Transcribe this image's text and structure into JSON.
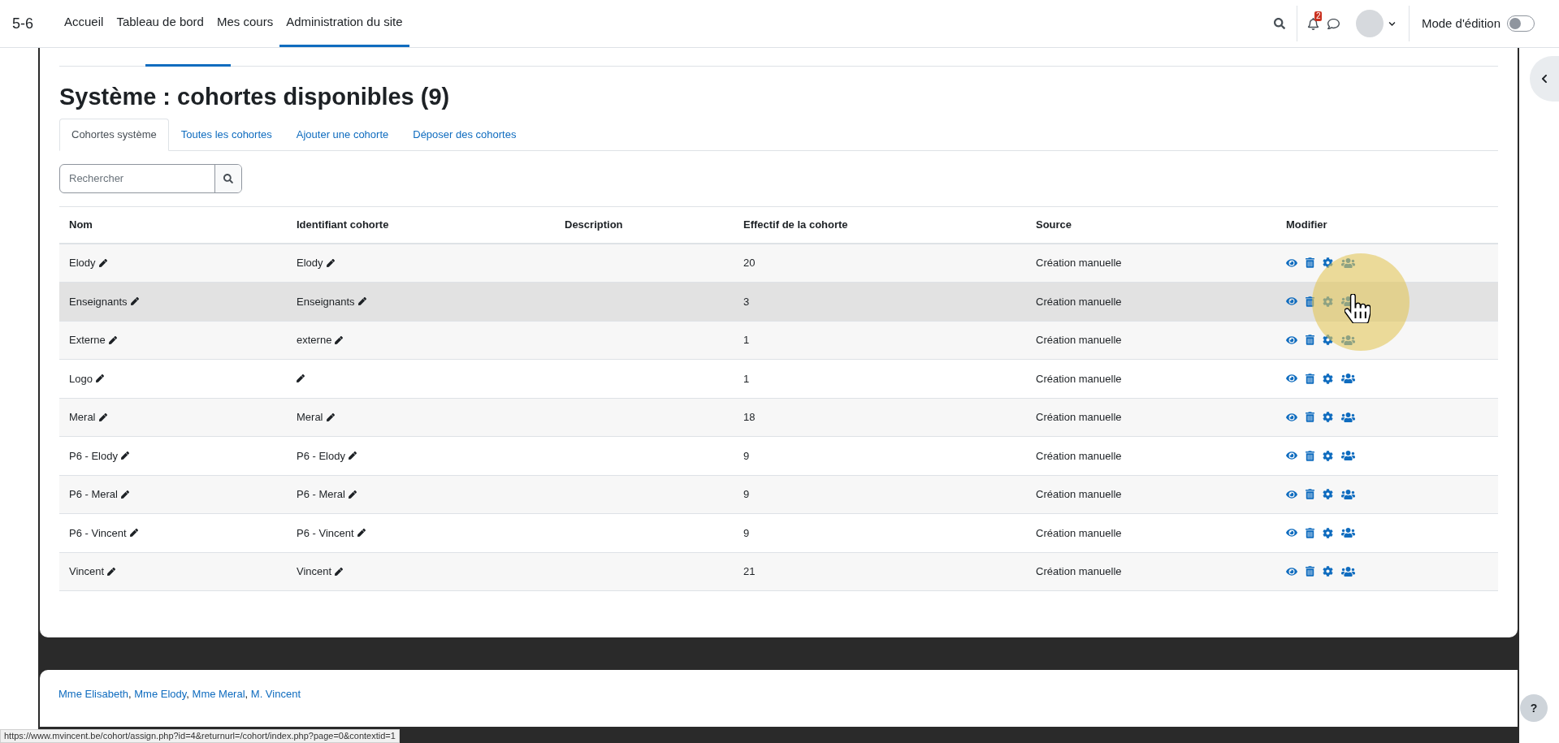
{
  "navbar": {
    "brand": "5-6",
    "items": [
      {
        "label": "Accueil",
        "selected": false
      },
      {
        "label": "Tableau de bord",
        "selected": false
      },
      {
        "label": "Mes cours",
        "selected": false
      },
      {
        "label": "Administration du site",
        "selected": true
      }
    ],
    "notifications": "2",
    "edit_mode": {
      "label": "Mode d'édition",
      "on": false
    }
  },
  "heading": "Système : cohortes disponibles (9)",
  "tabs": [
    {
      "label": "Cohortes système",
      "selected": true
    },
    {
      "label": "Toutes les cohortes",
      "selected": false
    },
    {
      "label": "Ajouter une cohorte",
      "selected": false
    },
    {
      "label": "Déposer des cohortes",
      "selected": false
    }
  ],
  "search": {
    "placeholder": "Rechercher"
  },
  "table": {
    "columns": [
      "Nom",
      "Identifiant cohorte",
      "Description",
      "Effectif de la cohorte",
      "Source",
      "Modifier"
    ],
    "rows": [
      {
        "name": "Elody",
        "identifier": "Elody",
        "size": "20",
        "source": "Création manuelle",
        "hovered": false
      },
      {
        "name": "Enseignants",
        "identifier": "Enseignants",
        "size": "3",
        "source": "Création manuelle",
        "hovered": true
      },
      {
        "name": "Externe",
        "identifier": "externe",
        "size": "1",
        "source": "Création manuelle",
        "hovered": false
      },
      {
        "name": "Logo",
        "size": "1",
        "source": "Création manuelle",
        "hovered": false
      },
      {
        "name": "Meral",
        "identifier": "Meral",
        "size": "18",
        "source": "Création manuelle",
        "hovered": false
      },
      {
        "name": "P6 - Elody",
        "identifier": "P6 - Elody",
        "size": "9",
        "source": "Création manuelle",
        "hovered": false
      },
      {
        "name": "P6 - Meral",
        "identifier": "P6 - Meral",
        "size": "9",
        "source": "Création manuelle",
        "hovered": false
      },
      {
        "name": "P6 - Vincent",
        "identifier": "P6 - Vincent",
        "size": "9",
        "source": "Création manuelle",
        "hovered": false
      },
      {
        "name": "Vincent",
        "identifier": "Vincent",
        "size": "21",
        "source": "Création manuelle",
        "hovered": false
      }
    ]
  },
  "footer": {
    "links": [
      {
        "label": "Mme Elisabeth",
        "separator": ","
      },
      {
        "label": "Mme Elody",
        "separator": ","
      },
      {
        "label": "Mme Meral",
        "separator": ","
      },
      {
        "label": "M. Vincent"
      }
    ]
  },
  "help_button": "?",
  "status_bar": {
    "url": "https://www.mvincent.be/cohort/assign.php?id=4&returnurl=/cohort/index.php?page=0&contextid=1"
  }
}
